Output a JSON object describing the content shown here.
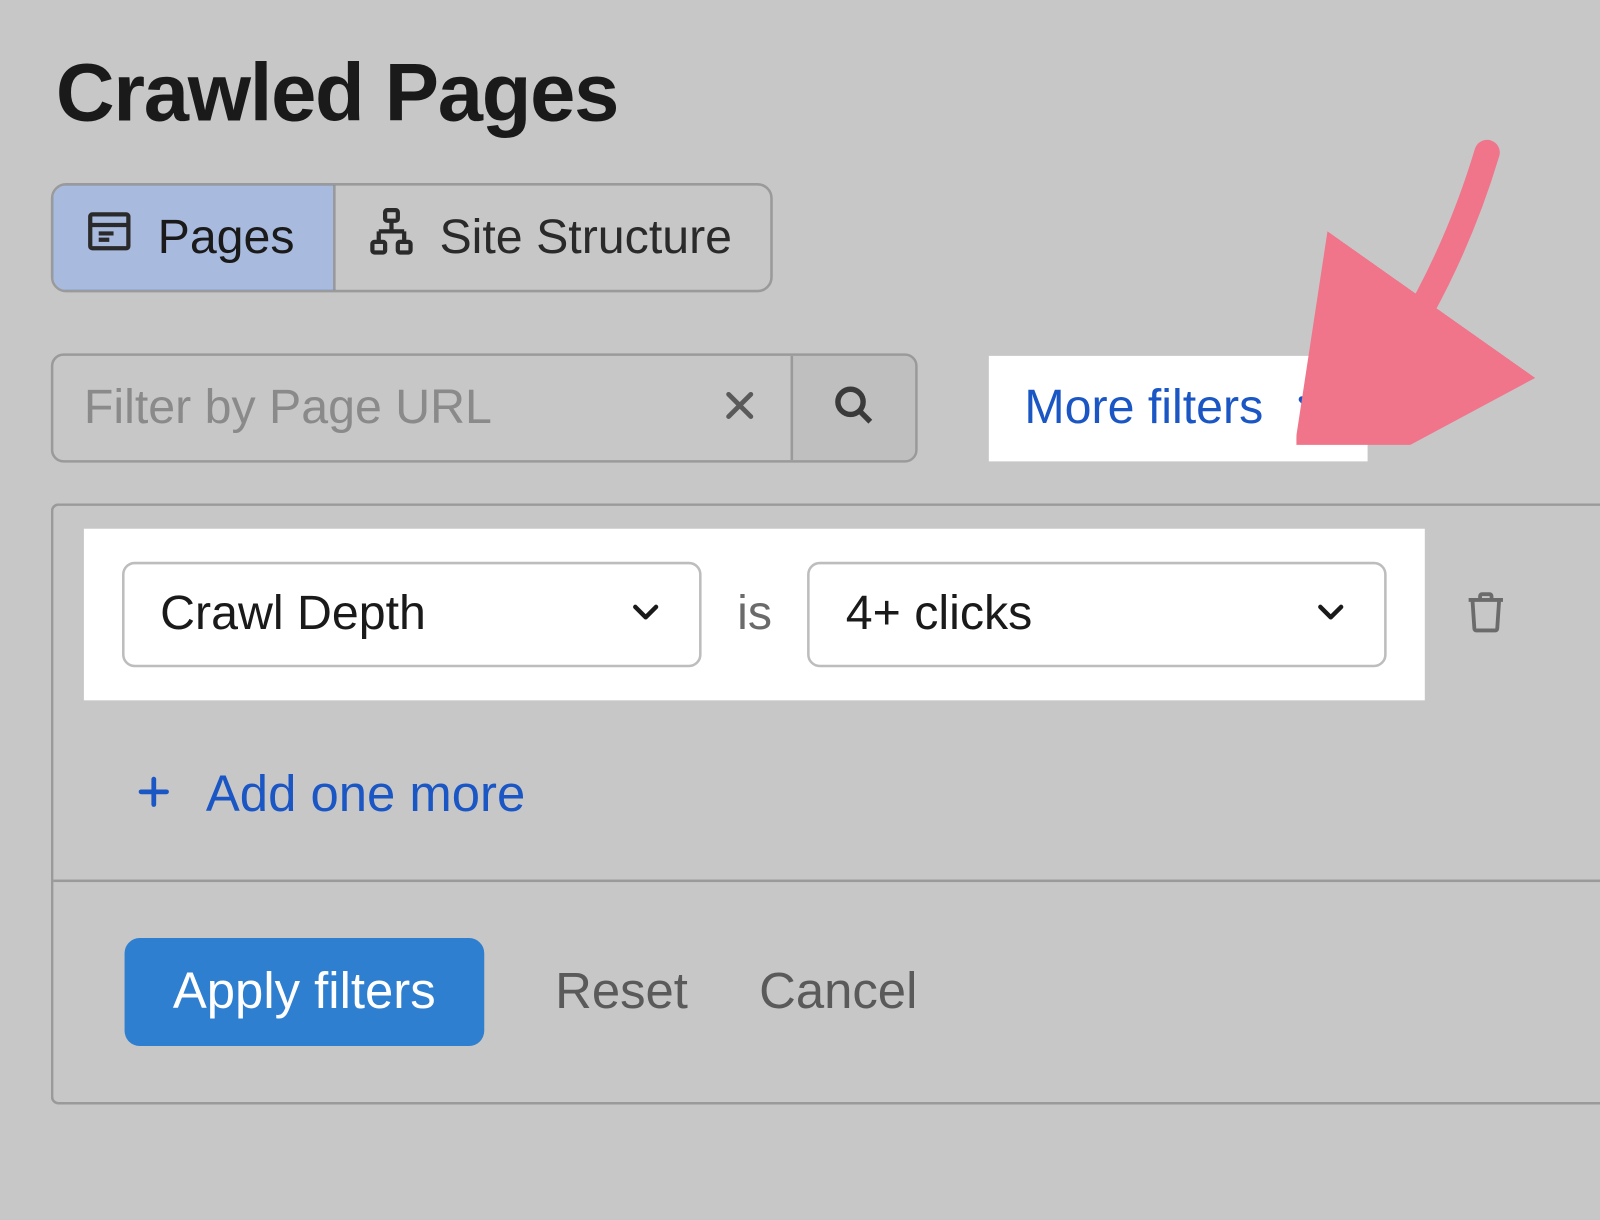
{
  "title": "Crawled Pages",
  "tabs": {
    "pages": "Pages",
    "site_structure": "Site Structure"
  },
  "search": {
    "placeholder": "Filter by Page URL"
  },
  "more_filters_label": "More filters",
  "filter": {
    "field": "Crawl Depth",
    "operator": "is",
    "value": "4+ clicks"
  },
  "add_more_label": "Add one more",
  "footer": {
    "apply": "Apply filters",
    "reset": "Reset",
    "cancel": "Cancel"
  }
}
